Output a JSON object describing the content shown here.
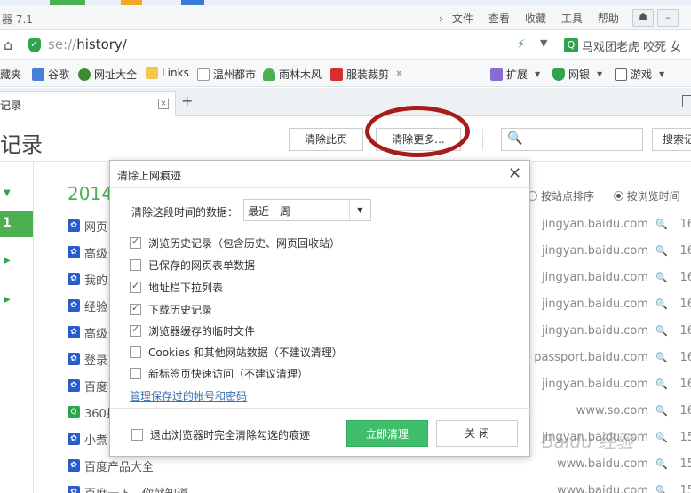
{
  "window": {
    "title": "器 7.1"
  },
  "menu": {
    "items": [
      "文件",
      "查看",
      "收藏",
      "工具",
      "帮助"
    ]
  },
  "address": {
    "scheme": "se://",
    "path": "history/",
    "search_text": "马戏团老虎 咬死 女"
  },
  "bookmarks": [
    {
      "label": "藏夹",
      "icon": "favorites-icon"
    },
    {
      "label": "谷歌",
      "icon": "google-icon"
    },
    {
      "label": "网址大全",
      "icon": "site-nav-icon"
    },
    {
      "label": "Links",
      "icon": "folder-icon"
    },
    {
      "label": "温州都市",
      "icon": "page-icon"
    },
    {
      "label": "雨林木风",
      "icon": "tree-icon"
    },
    {
      "label": "服装裁剪",
      "icon": "scissors-icon"
    },
    {
      "label": "扩展",
      "icon": "extension-icon"
    },
    {
      "label": "网银",
      "icon": "bank-icon"
    },
    {
      "label": "游戏",
      "icon": "game-icon"
    }
  ],
  "tab": {
    "label": "记录"
  },
  "page": {
    "title": "记录",
    "clear_page_label": "清除此页",
    "clear_more_label": "清除更多...",
    "search_button": "搜索记",
    "year": "2014",
    "sidebar_active": "1",
    "sort_by_site": "按站点排序",
    "sort_by_time": "按浏览时间"
  },
  "history": [
    {
      "title": "网页",
      "domain": "jingyan.baidu.com",
      "time": "16",
      "fav": "paw"
    },
    {
      "title": "高级",
      "domain": "jingyan.baidu.com",
      "time": "16",
      "fav": "paw"
    },
    {
      "title": "我的",
      "domain": "jingyan.baidu.com",
      "time": "16",
      "fav": "paw"
    },
    {
      "title": "经验",
      "domain": "jingyan.baidu.com",
      "time": "16",
      "fav": "paw"
    },
    {
      "title": "高级",
      "domain": "jingyan.baidu.com",
      "time": "16",
      "fav": "paw"
    },
    {
      "title": "登录",
      "domain": "passport.baidu.com",
      "time": "16",
      "fav": "paw"
    },
    {
      "title": "百度",
      "domain": "jingyan.baidu.com",
      "time": "16",
      "fav": "paw"
    },
    {
      "title": "360搜",
      "domain": "www.so.com",
      "time": "16",
      "fav": "search"
    },
    {
      "title": "小煮",
      "domain": "jingyan.baidu.com",
      "time": "15",
      "fav": "paw"
    },
    {
      "title": "百度产品大全",
      "domain": "www.baidu.com",
      "time": "15",
      "fav": "paw"
    },
    {
      "title": "百度一下，你就知道",
      "domain": "www.baidu.com",
      "time": "15",
      "fav": "paw"
    }
  ],
  "dialog": {
    "title": "清除上网痕迹",
    "range_label": "清除这段时间的数据：",
    "range_value": "最近一周",
    "options": [
      {
        "label": "浏览历史记录（包含历史、网页回收站）",
        "checked": true
      },
      {
        "label": "已保存的网页表单数据",
        "checked": false
      },
      {
        "label": "地址栏下拉列表",
        "checked": true
      },
      {
        "label": "下载历史记录",
        "checked": true
      },
      {
        "label": "浏览器缓存的临时文件",
        "checked": true
      },
      {
        "label": "Cookies 和其他网站数据（不建议清理）",
        "checked": false
      },
      {
        "label": "新标签页快速访问（不建议清理）",
        "checked": false
      }
    ],
    "manage_link": "管理保存过的帐号和密码",
    "exit_clear_label": "退出浏览器时完全清除勾选的痕迹",
    "clear_now": "立即清理",
    "close": "关 闭"
  },
  "watermark": "Baidu 经验",
  "colors": {
    "accent": "#4caf50",
    "primary_button": "#3fbf6b",
    "annotation": "#a81b1b"
  }
}
